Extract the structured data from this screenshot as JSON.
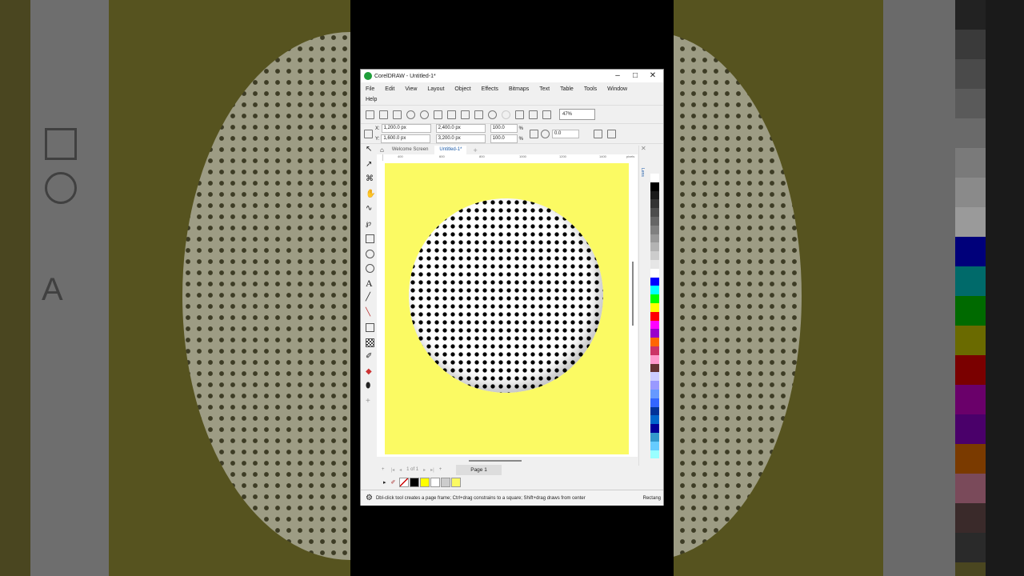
{
  "app": {
    "title": "CorelDRAW - Untitled-1*",
    "window_buttons": [
      "–",
      "□",
      "✕"
    ]
  },
  "menu": [
    "File",
    "Edit",
    "View",
    "Layout",
    "Object",
    "Effects",
    "Bitmaps",
    "Text",
    "Table",
    "Tools",
    "Window",
    "Help"
  ],
  "toolbar": {
    "zoom": "47%"
  },
  "properties": {
    "x": "1,200.0 px",
    "y": "1,600.0 px",
    "width": "2,400.0 px",
    "height": "3,200.0 px",
    "scale_w": "100.0",
    "scale_h": "100.0",
    "percent_w": "%",
    "percent_h": "%",
    "rotation": "0.0",
    "x_label": "X:",
    "y_label": "Y:"
  },
  "tabs": [
    {
      "label": "Welcome Screen",
      "active": false
    },
    {
      "label": "Untitled-1*",
      "active": true
    }
  ],
  "ruler_ticks": [
    "400",
    "600",
    "800",
    "1000",
    "1200",
    "1400",
    "pixels"
  ],
  "docker": {
    "label": "Lens"
  },
  "page_nav": {
    "counter": "1 of 1",
    "page_tab": "Page 1"
  },
  "status": {
    "hint": "Dbl-click tool creates a page frame; Ctrl+drag constrains to a square; Shift+drag draws from center",
    "tool": "Rectang"
  },
  "colors": {
    "page": "#fbfa63",
    "palette": [
      "#ffffff",
      "#000000",
      "#1a1a1a",
      "#333333",
      "#4d4d4d",
      "#666666",
      "#808080",
      "#999999",
      "#b3b3b3",
      "#cccccc",
      "#e6e6e6",
      "#ffffff",
      "#0000ff",
      "#00ffff",
      "#00ff00",
      "#ffff00",
      "#ff0000",
      "#ff00ff",
      "#9900cc",
      "#ff6600",
      "#cc3366",
      "#ff99cc",
      "#663333",
      "#ccccff",
      "#9999ff",
      "#6699ff",
      "#3366ff",
      "#003399",
      "#0066cc",
      "#000099",
      "#3399cc",
      "#66ccff",
      "#99ffff"
    ],
    "document_palette": [
      "#000000",
      "#ffff00",
      "#ffffff",
      "#cccccc",
      "#fbfa63"
    ]
  }
}
